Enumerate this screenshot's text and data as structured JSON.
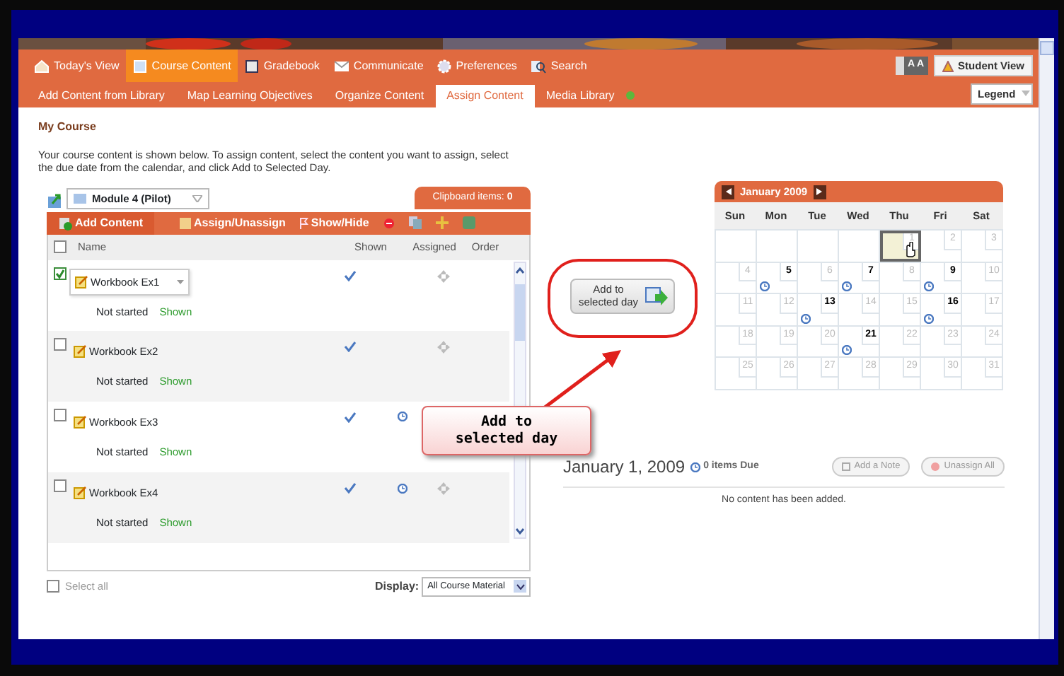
{
  "nav": {
    "items": [
      {
        "label": "Today's View",
        "selected": false
      },
      {
        "label": "Course Content",
        "selected": true
      },
      {
        "label": "Gradebook",
        "selected": false
      },
      {
        "label": "Communicate",
        "selected": false
      },
      {
        "label": "Preferences",
        "selected": false
      },
      {
        "label": "Search",
        "selected": false
      }
    ],
    "text_size": "A A",
    "student_view": "Student View"
  },
  "subnav": {
    "items": [
      {
        "label": "Add Content from Library",
        "selected": false
      },
      {
        "label": "Map Learning Objectives",
        "selected": false
      },
      {
        "label": "Organize Content",
        "selected": false
      },
      {
        "label": "Assign Content",
        "selected": true
      },
      {
        "label": "Media Library",
        "selected": false
      }
    ],
    "legend": "Legend"
  },
  "page_title": "My Course",
  "intro": "Your course content is shown below. To assign content, select the content you want to assign, select the due date from the calendar, and click Add to Selected Day.",
  "module_select": "Module 4 (Pilot)",
  "clipboard": {
    "label": "Clipboard items:",
    "count": "0"
  },
  "toolbar": {
    "add_content": "Add Content",
    "assign": "Assign/Unassign",
    "show_hide": "Show/Hide"
  },
  "table": {
    "columns": [
      "Name",
      "Shown",
      "Assigned",
      "Order"
    ],
    "header_checked": false,
    "rows": [
      {
        "name": "Workbook Ex1",
        "status": "Not started",
        "visibility": "Shown",
        "checked": true,
        "hovered": true,
        "shown": true,
        "assigned": false,
        "drag_handle": true
      },
      {
        "name": "Workbook Ex2",
        "status": "Not started",
        "visibility": "Shown",
        "checked": false,
        "hovered": false,
        "shown": true,
        "assigned": false,
        "drag_handle": true
      },
      {
        "name": "Workbook Ex3",
        "status": "Not started",
        "visibility": "Shown",
        "checked": false,
        "hovered": false,
        "shown": true,
        "assigned": true,
        "drag_handle": false
      },
      {
        "name": "Workbook Ex4",
        "status": "Not started",
        "visibility": "Shown",
        "checked": false,
        "hovered": false,
        "shown": true,
        "assigned": true,
        "drag_handle": true
      }
    ]
  },
  "select_all": {
    "label": "Select all",
    "checked": false
  },
  "display": {
    "label": "Display:",
    "value": "All Course Material"
  },
  "add_button": "Add to selected day",
  "callout": "Add to selected day",
  "calendar": {
    "month": "January 2009",
    "weekdays": [
      "Sun",
      "Mon",
      "Tue",
      "Wed",
      "Thu",
      "Fri",
      "Sat"
    ],
    "weeks": [
      [
        {
          "kind": "blank"
        },
        {
          "kind": "blank"
        },
        {
          "kind": "blank"
        },
        {
          "kind": "blank"
        },
        {
          "day": "1",
          "has_items": false,
          "selected": true
        },
        {
          "day": "2",
          "has_items": false,
          "selected": false
        },
        {
          "day": "3",
          "has_items": false,
          "selected": false
        }
      ],
      [
        {
          "day": "4",
          "has_items": false,
          "selected": false
        },
        {
          "day": "5",
          "has_items": true,
          "selected": false
        },
        {
          "day": "6",
          "has_items": false,
          "selected": false
        },
        {
          "day": "7",
          "has_items": true,
          "selected": false
        },
        {
          "day": "8",
          "has_items": false,
          "selected": false
        },
        {
          "day": "9",
          "has_items": true,
          "selected": false
        },
        {
          "day": "10",
          "has_items": false,
          "selected": false
        }
      ],
      [
        {
          "day": "11",
          "has_items": false,
          "selected": false
        },
        {
          "day": "12",
          "has_items": false,
          "selected": false
        },
        {
          "day": "13",
          "has_items": true,
          "selected": false
        },
        {
          "day": "14",
          "has_items": false,
          "selected": false
        },
        {
          "day": "15",
          "has_items": false,
          "selected": false
        },
        {
          "day": "16",
          "has_items": true,
          "selected": false
        },
        {
          "day": "17",
          "has_items": false,
          "selected": false
        }
      ],
      [
        {
          "day": "18",
          "has_items": false,
          "selected": false
        },
        {
          "day": "19",
          "has_items": false,
          "selected": false
        },
        {
          "day": "20",
          "has_items": false,
          "selected": false
        },
        {
          "day": "21",
          "has_items": true,
          "selected": false
        },
        {
          "day": "22",
          "has_items": false,
          "selected": false
        },
        {
          "day": "23",
          "has_items": false,
          "selected": false
        },
        {
          "day": "24",
          "has_items": false,
          "selected": false
        }
      ],
      [
        {
          "day": "25",
          "has_items": false,
          "selected": false
        },
        {
          "day": "26",
          "has_items": false,
          "selected": false
        },
        {
          "day": "27",
          "has_items": false,
          "selected": false
        },
        {
          "day": "28",
          "has_items": false,
          "selected": false
        },
        {
          "day": "29",
          "has_items": false,
          "selected": false
        },
        {
          "day": "30",
          "has_items": false,
          "selected": false
        },
        {
          "day": "31",
          "has_items": false,
          "selected": false
        }
      ]
    ]
  },
  "day_detail": {
    "date": "January 1, 2009",
    "count": "0",
    "items_label": "items Due",
    "add_note": "Add a Note",
    "unassign_all": "Unassign All",
    "empty": "No content has been added."
  }
}
